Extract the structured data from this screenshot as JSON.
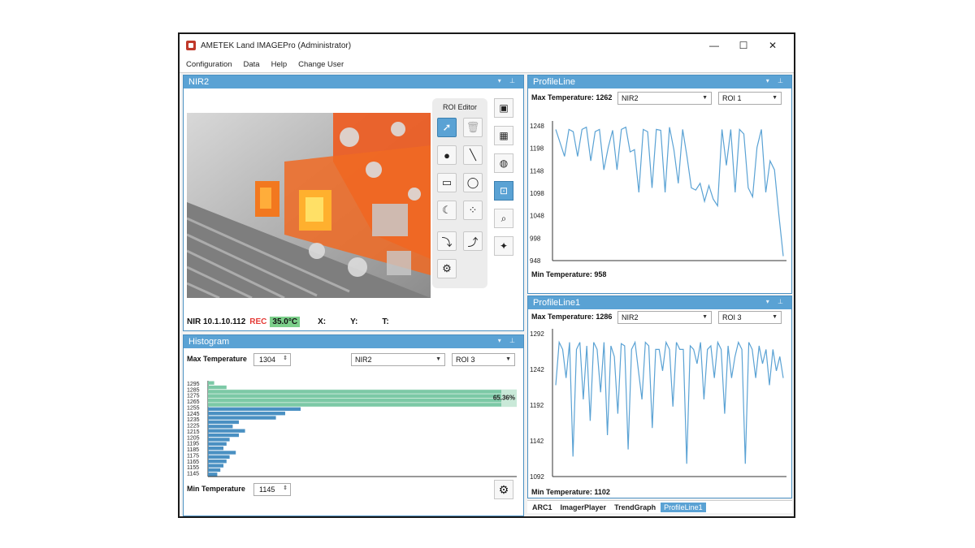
{
  "window": {
    "title": "AMETEK Land IMAGEPro (Administrator)",
    "minimize": "—",
    "maximize": "☐",
    "close": "✕"
  },
  "menu": [
    "Configuration",
    "Data",
    "Help",
    "Change User"
  ],
  "nir_panel": {
    "title": "NIR2",
    "roi_editor_title": "ROI Editor",
    "status": {
      "device": "NIR 10.1.10.112",
      "rec": "REC",
      "temp": "35.0°C",
      "x": "X:",
      "y": "Y:",
      "t": "T:"
    }
  },
  "histogram": {
    "title": "Histogram",
    "max_label": "Max Temperature",
    "max_value": "1304",
    "min_label": "Min Temperature",
    "min_value": "1145",
    "source": "NIR2",
    "roi": "ROI 3",
    "percent": "65.36%",
    "y_ticks": [
      "1295",
      "1285",
      "1275",
      "1265",
      "1255",
      "1245",
      "1235",
      "1225",
      "1215",
      "1205",
      "1195",
      "1185",
      "1175",
      "1165",
      "1155",
      "1145"
    ],
    "bars": [
      0.02,
      0.06,
      0.95,
      0.95,
      0.95,
      0.95,
      0.3,
      0.25,
      0.22,
      0.1,
      0.08,
      0.12,
      0.1,
      0.07,
      0.06,
      0.05,
      0.09,
      0.07,
      0.06,
      0.05,
      0.04,
      0.03
    ],
    "colors": {
      "green": "#7cc9a6",
      "blue": "#4a90c2",
      "band": "#c9e9d8"
    }
  },
  "profile1": {
    "title": "ProfileLine",
    "max_label": "Max Temperature: 1262",
    "min_label": "Min Temperature: 958",
    "source": "NIR2",
    "roi": "ROI 1",
    "y_ticks": [
      "1248",
      "1198",
      "1148",
      "1098",
      "1048",
      "998",
      "948"
    ],
    "ylim": [
      948,
      1248
    ],
    "values": [
      1240,
      1210,
      1180,
      1240,
      1235,
      1180,
      1240,
      1245,
      1170,
      1235,
      1240,
      1150,
      1200,
      1238,
      1150,
      1240,
      1245,
      1190,
      1195,
      1100,
      1240,
      1235,
      1110,
      1240,
      1238,
      1100,
      1245,
      1195,
      1120,
      1240,
      1180,
      1110,
      1105,
      1120,
      1080,
      1115,
      1085,
      1070,
      1240,
      1160,
      1240,
      1100,
      1240,
      1230,
      1110,
      1090,
      1200,
      1240,
      1100,
      1170,
      1150,
      1050,
      958
    ]
  },
  "profile2": {
    "title": "ProfileLine1",
    "max_label": "Max Temperature: 1286",
    "min_label": "Min Temperature: 1102",
    "source": "NIR2",
    "roi": "ROI 3",
    "y_ticks": [
      "1292",
      "1242",
      "1192",
      "1142",
      "1092"
    ],
    "ylim": [
      1092,
      1292
    ],
    "values": [
      1220,
      1280,
      1270,
      1230,
      1280,
      1120,
      1270,
      1280,
      1200,
      1275,
      1170,
      1280,
      1270,
      1210,
      1280,
      1150,
      1275,
      1260,
      1180,
      1278,
      1275,
      1130,
      1270,
      1280,
      1240,
      1200,
      1280,
      1275,
      1160,
      1270,
      1270,
      1240,
      1280,
      1270,
      1190,
      1280,
      1270,
      1270,
      1110,
      1275,
      1270,
      1250,
      1280,
      1200,
      1270,
      1275,
      1230,
      1280,
      1270,
      1180,
      1275,
      1230,
      1260,
      1280,
      1270,
      1110,
      1280,
      1270,
      1230,
      1275,
      1250,
      1270,
      1220,
      1270,
      1240,
      1260,
      1230
    ]
  },
  "tabs": [
    "ARC1",
    "ImagerPlayer",
    "TrendGraph",
    "ProfileLine1"
  ],
  "accent": "#5aa2d4",
  "line_color": "#5aa2d4"
}
